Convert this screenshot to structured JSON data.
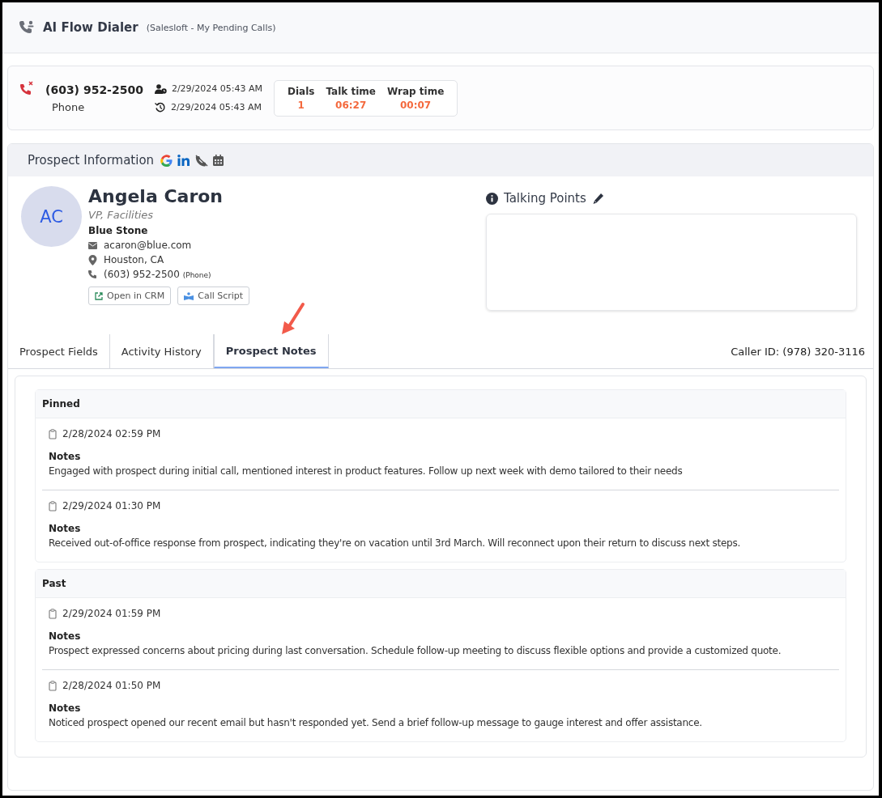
{
  "header": {
    "title": "AI Flow Dialer",
    "subtitle": "(Salesloft - My Pending Calls)"
  },
  "call": {
    "number": "(603) 952-2500",
    "type": "Phone",
    "assigned": "2/29/2024 05:43 AM",
    "last": "2/29/2024 05:43 AM",
    "stats": [
      {
        "label": "Dials",
        "value": "1"
      },
      {
        "label": "Talk time",
        "value": "06:27"
      },
      {
        "label": "Wrap time",
        "value": "00:07"
      }
    ]
  },
  "prospect_panel": {
    "title": "Prospect Information"
  },
  "prospect": {
    "initials": "AC",
    "name": "Angela Caron",
    "job_title": "VP, Facilities",
    "company": "Blue Stone",
    "email": "acaron@blue.com",
    "location": "Houston, CA",
    "phone": "(603) 952-2500",
    "phone_type": "(Phone)",
    "buttons": [
      {
        "kind": "crm",
        "label": "Open in CRM"
      },
      {
        "kind": "script",
        "label": "Call Script"
      }
    ]
  },
  "talking_points": {
    "title": "Talking Points"
  },
  "tabs": [
    {
      "label": "Prospect Fields",
      "selected": false
    },
    {
      "label": "Activity History",
      "selected": false
    },
    {
      "label": "Prospect Notes",
      "selected": true
    }
  ],
  "caller_id": "Caller ID: (978) 320-3116",
  "note_groups": [
    {
      "title": "Pinned",
      "notes": [
        {
          "date": "2/28/2024 02:59 PM",
          "heading": "Notes",
          "text": "Engaged with prospect during initial call, mentioned interest in product features. Follow up next week with demo tailored to their needs"
        },
        {
          "date": "2/29/2024 01:30 PM",
          "heading": "Notes",
          "text": "Received out-of-office response from prospect, indicating they're on vacation until 3rd March. Will reconnect upon their return to discuss next steps."
        }
      ]
    },
    {
      "title": "Past",
      "notes": [
        {
          "date": "2/29/2024 01:59 PM",
          "heading": "Notes",
          "text": "Prospect expressed concerns about pricing during last conversation. Schedule follow-up meeting to discuss flexible options and provide a customized quote."
        },
        {
          "date": "2/28/2024 01:50 PM",
          "heading": "Notes",
          "text": "Noticed prospect opened our recent email but hasn't responded yet. Send a brief follow-up message to gauge interest and offer assistance."
        }
      ]
    }
  ]
}
